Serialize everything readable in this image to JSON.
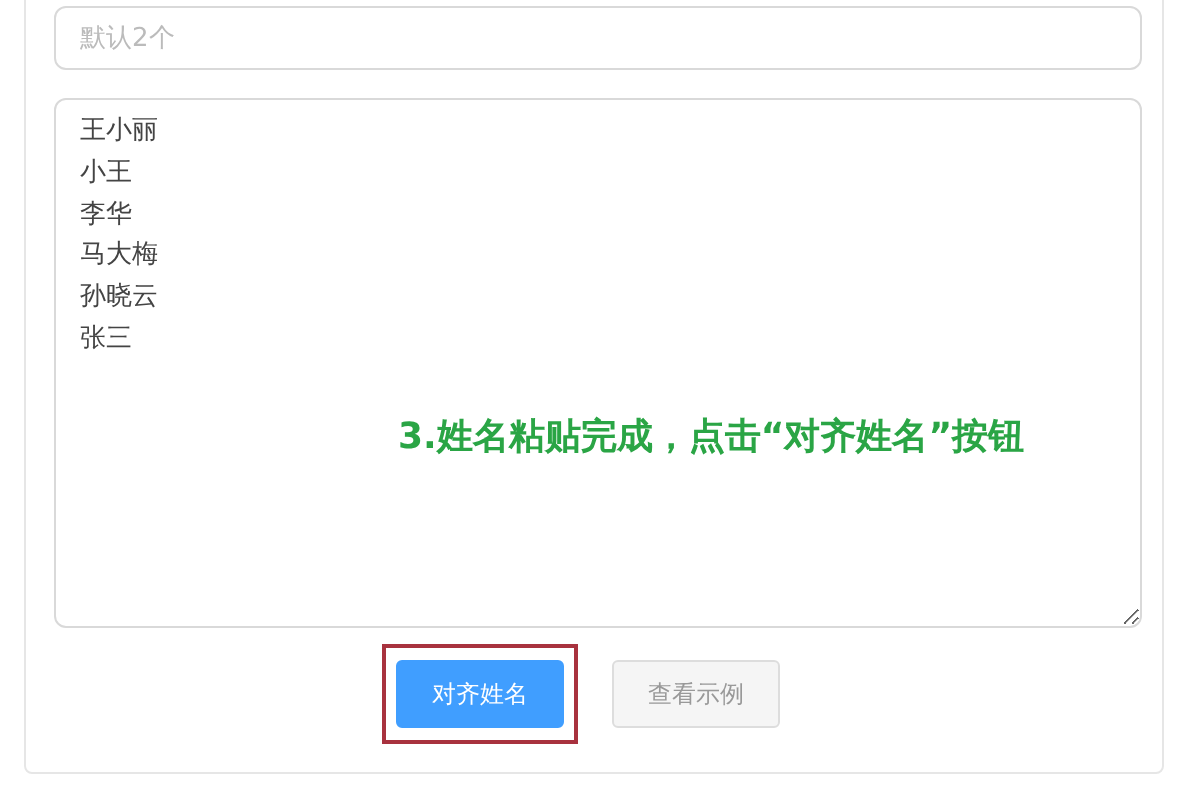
{
  "count_field": {
    "placeholder": "默认2个"
  },
  "names_box": {
    "lines": [
      "王小丽",
      "小王",
      "李华",
      "马大梅",
      "孙晓云",
      "张三"
    ]
  },
  "annotation": "3.姓名粘贴完成，点击“对齐姓名”按钮",
  "buttons": [
    {
      "label": "对齐姓名",
      "kind": "primary",
      "highlighted": true
    },
    {
      "label": "查看示例",
      "kind": "secondary",
      "highlighted": false
    }
  ]
}
